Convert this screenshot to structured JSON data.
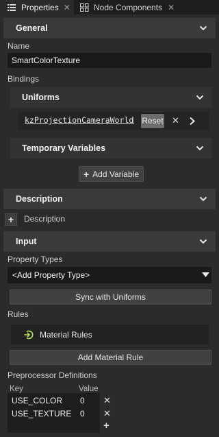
{
  "tabs": [
    {
      "label": "Properties",
      "active": true,
      "icon": "list-icon"
    },
    {
      "label": "Node Components",
      "active": false,
      "icon": "node-components-icon"
    }
  ],
  "sections": {
    "general": "General",
    "description": "Description",
    "input": "Input"
  },
  "name": {
    "label": "Name",
    "value": "SmartColorTexture"
  },
  "bindings": {
    "label": "Bindings",
    "uniforms": {
      "label": "Uniforms",
      "row": {
        "name": "kzProjectionCameraWorldMatrix",
        "reset_label": "Reset"
      }
    },
    "temporary_variables": {
      "label": "Temporary Variables"
    },
    "add_variable_label": "Add Variable"
  },
  "description": {
    "item_label": "Description"
  },
  "input": {
    "property_types_label": "Property Types",
    "property_type_dropdown": "<Add Property Type>",
    "sync_label": "Sync with Uniforms",
    "rules_label": "Rules",
    "material_rules_label": "Material Rules",
    "add_material_rule_label": "Add Material Rule",
    "preprocessor": {
      "label": "Preprocessor Definitions",
      "columns": [
        "Key",
        "Value"
      ],
      "rows": [
        {
          "key": "USE_COLOR",
          "value": "0"
        },
        {
          "key": "USE_TEXTURE",
          "value": "0"
        }
      ]
    }
  },
  "colors": {
    "background": "#2b2b2b",
    "section_header": "#3a3a3a",
    "field": "#1a1a1a",
    "rules_icon_green": "#b7e04a"
  }
}
